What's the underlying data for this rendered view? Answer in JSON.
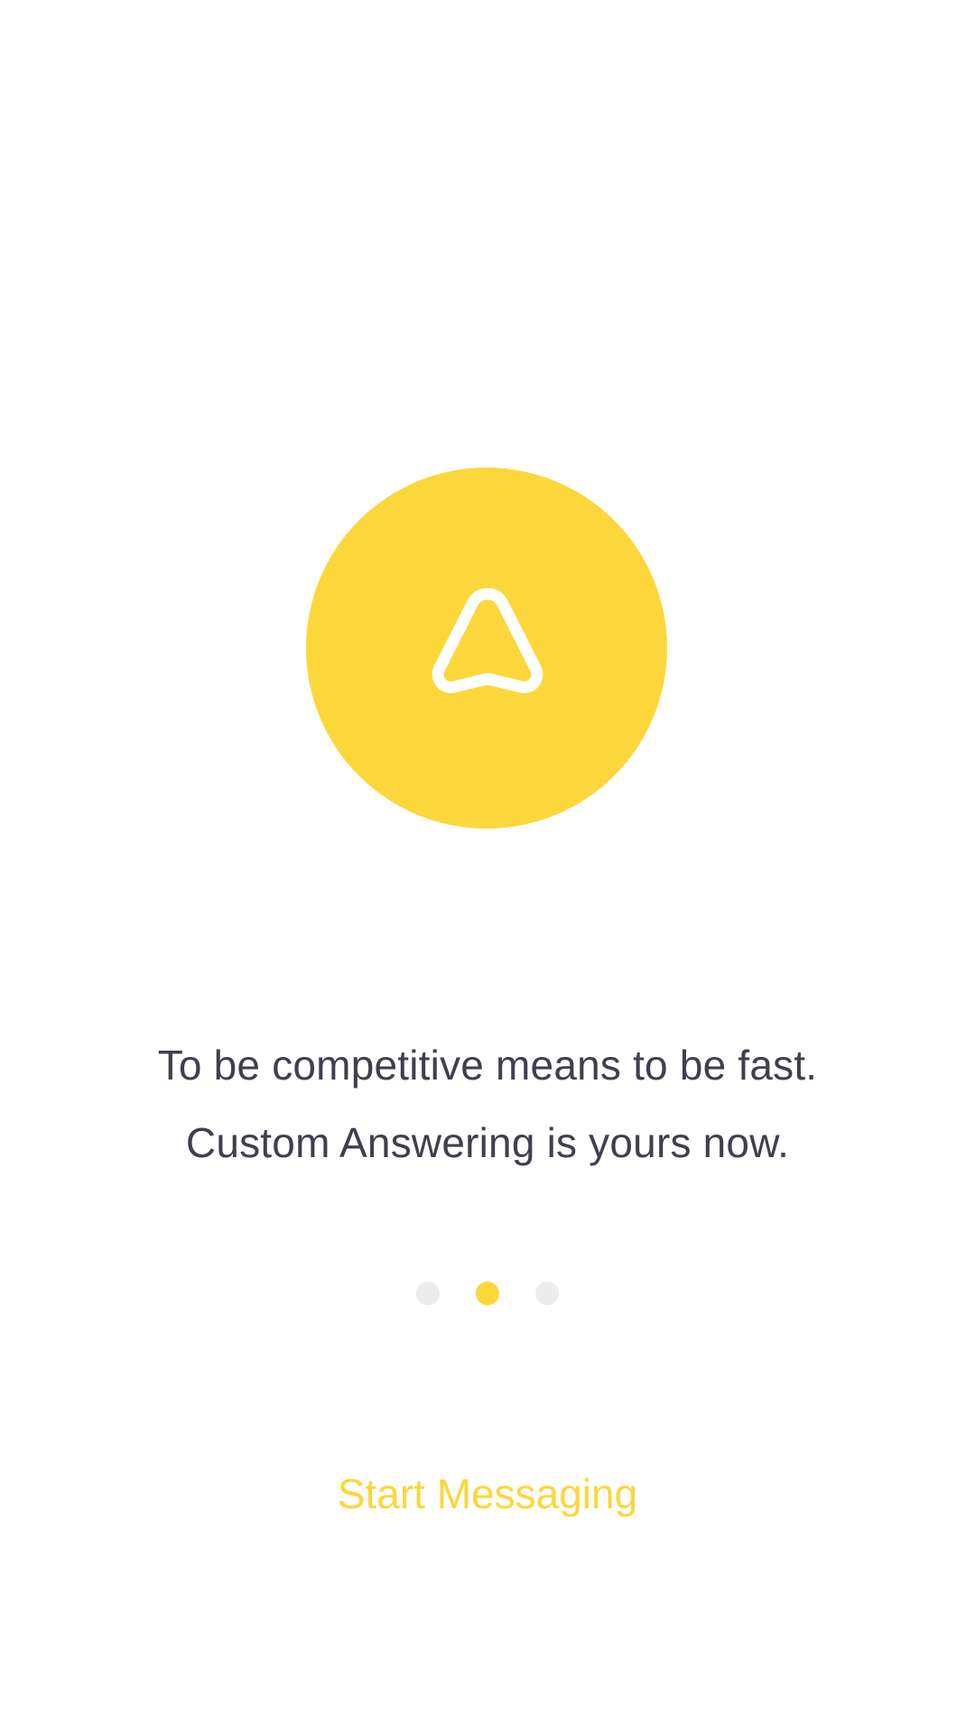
{
  "hero": {
    "icon": "navigation-arrow-icon",
    "circle_color": "#FCD73C",
    "icon_color": "#FFFFFF"
  },
  "tagline": {
    "line1": "To be competitive means to be fast.",
    "line2": "Custom Answering is yours now."
  },
  "pagination": {
    "total": 3,
    "active_index": 1,
    "active_color": "#FCD73C",
    "inactive_color": "#ECECEC"
  },
  "cta": {
    "label": "Start Messaging",
    "color": "#FCD73C"
  }
}
